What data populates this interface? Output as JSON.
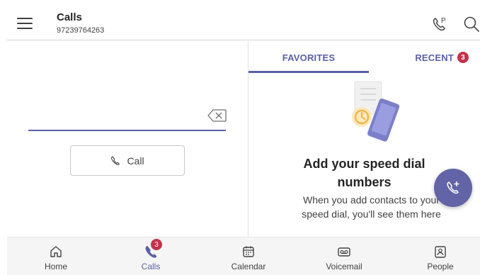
{
  "header": {
    "title": "Calls",
    "subtitle": "97239764263"
  },
  "dialer": {
    "call_label": "Call"
  },
  "tabs": {
    "favorites": "FAVORITES",
    "recent": "RECENT",
    "recent_badge": "3"
  },
  "empty_state": {
    "title_line1": "Add your speed dial",
    "title_line2": "numbers",
    "desc_line1": "When you add contacts to your",
    "desc_line2": "speed dial, you'll see them here"
  },
  "nav": {
    "items": [
      {
        "label": "Home",
        "icon": "home-icon"
      },
      {
        "label": "Calls",
        "icon": "phone-icon",
        "badge": "3"
      },
      {
        "label": "Calendar",
        "icon": "calendar-icon"
      },
      {
        "label": "Voicemail",
        "icon": "voicemail-icon"
      },
      {
        "label": "People",
        "icon": "people-icon"
      }
    ]
  },
  "colors": {
    "accent": "#5b5fa8",
    "fab": "#6264a7",
    "badge": "#c4314b"
  }
}
